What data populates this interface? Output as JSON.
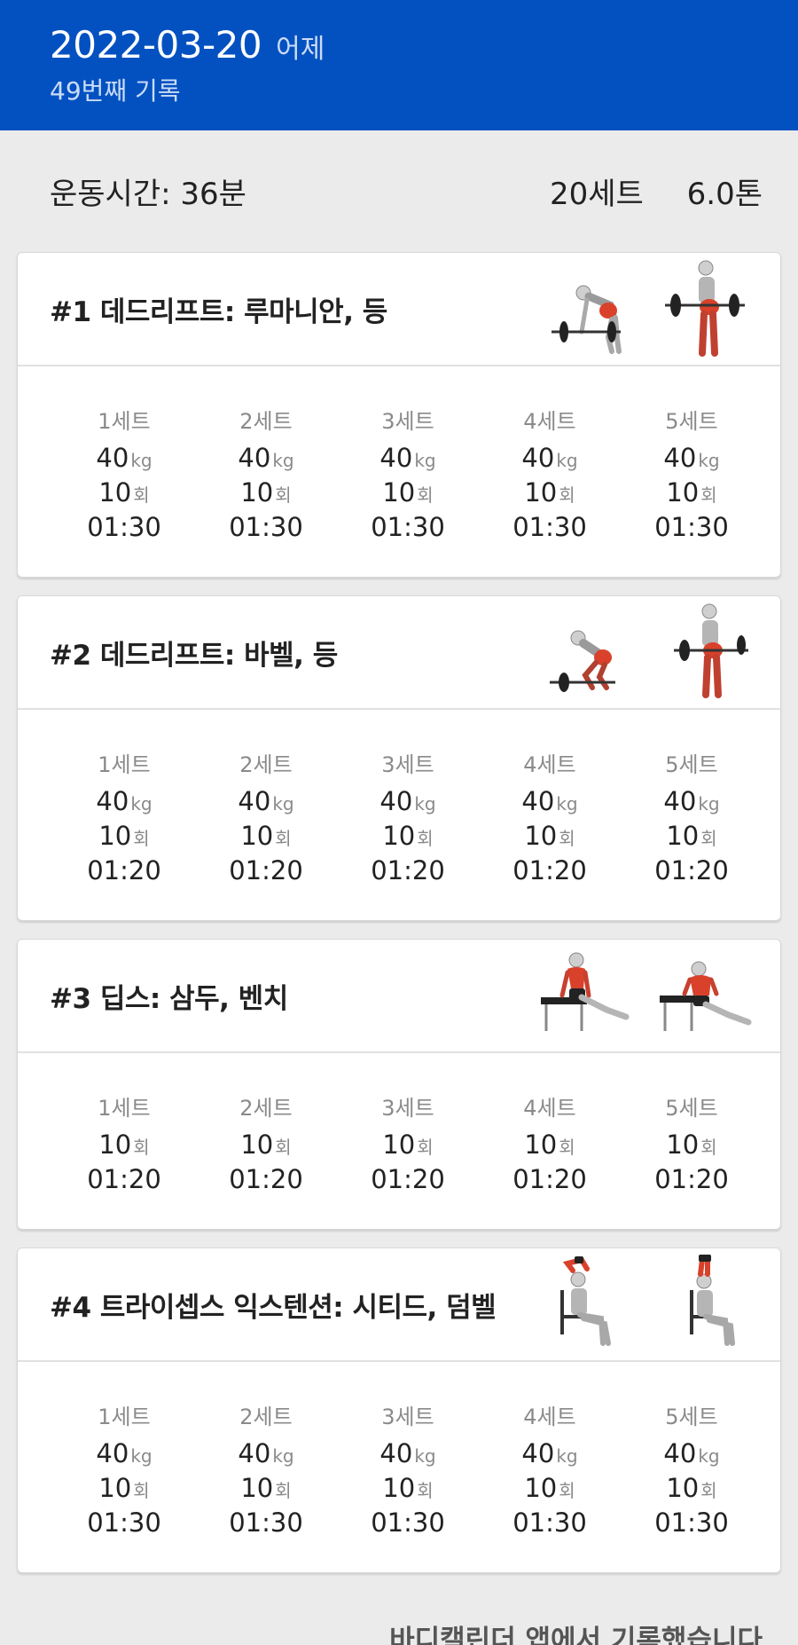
{
  "header": {
    "date": "2022-03-20",
    "relative": "어제",
    "count": "49번째 기록"
  },
  "summary": {
    "duration": "운동시간: 36분",
    "sets": "20세트",
    "tonnage": "6.0톤"
  },
  "exercises": [
    {
      "title": "#1 데드리프트: 루마니안, 등",
      "sets": [
        {
          "label": "1세트",
          "weight": "40",
          "weight_unit": "kg",
          "reps": "10",
          "reps_unit": "회",
          "rest": "01:30"
        },
        {
          "label": "2세트",
          "weight": "40",
          "weight_unit": "kg",
          "reps": "10",
          "reps_unit": "회",
          "rest": "01:30"
        },
        {
          "label": "3세트",
          "weight": "40",
          "weight_unit": "kg",
          "reps": "10",
          "reps_unit": "회",
          "rest": "01:30"
        },
        {
          "label": "4세트",
          "weight": "40",
          "weight_unit": "kg",
          "reps": "10",
          "reps_unit": "회",
          "rest": "01:30"
        },
        {
          "label": "5세트",
          "weight": "40",
          "weight_unit": "kg",
          "reps": "10",
          "reps_unit": "회",
          "rest": "01:30"
        }
      ]
    },
    {
      "title": "#2 데드리프트: 바벨, 등",
      "sets": [
        {
          "label": "1세트",
          "weight": "40",
          "weight_unit": "kg",
          "reps": "10",
          "reps_unit": "회",
          "rest": "01:20"
        },
        {
          "label": "2세트",
          "weight": "40",
          "weight_unit": "kg",
          "reps": "10",
          "reps_unit": "회",
          "rest": "01:20"
        },
        {
          "label": "3세트",
          "weight": "40",
          "weight_unit": "kg",
          "reps": "10",
          "reps_unit": "회",
          "rest": "01:20"
        },
        {
          "label": "4세트",
          "weight": "40",
          "weight_unit": "kg",
          "reps": "10",
          "reps_unit": "회",
          "rest": "01:20"
        },
        {
          "label": "5세트",
          "weight": "40",
          "weight_unit": "kg",
          "reps": "10",
          "reps_unit": "회",
          "rest": "01:20"
        }
      ]
    },
    {
      "title": "#3 딥스: 삼두, 벤치",
      "sets": [
        {
          "label": "1세트",
          "reps": "10",
          "reps_unit": "회",
          "rest": "01:20"
        },
        {
          "label": "2세트",
          "reps": "10",
          "reps_unit": "회",
          "rest": "01:20"
        },
        {
          "label": "3세트",
          "reps": "10",
          "reps_unit": "회",
          "rest": "01:20"
        },
        {
          "label": "4세트",
          "reps": "10",
          "reps_unit": "회",
          "rest": "01:20"
        },
        {
          "label": "5세트",
          "reps": "10",
          "reps_unit": "회",
          "rest": "01:20"
        }
      ]
    },
    {
      "title": "#4 트라이셉스 익스텐션: 시티드, 덤벨",
      "sets": [
        {
          "label": "1세트",
          "weight": "40",
          "weight_unit": "kg",
          "reps": "10",
          "reps_unit": "회",
          "rest": "01:30"
        },
        {
          "label": "2세트",
          "weight": "40",
          "weight_unit": "kg",
          "reps": "10",
          "reps_unit": "회",
          "rest": "01:30"
        },
        {
          "label": "3세트",
          "weight": "40",
          "weight_unit": "kg",
          "reps": "10",
          "reps_unit": "회",
          "rest": "01:30"
        },
        {
          "label": "4세트",
          "weight": "40",
          "weight_unit": "kg",
          "reps": "10",
          "reps_unit": "회",
          "rest": "01:30"
        },
        {
          "label": "5세트",
          "weight": "40",
          "weight_unit": "kg",
          "reps": "10",
          "reps_unit": "회",
          "rest": "01:30"
        }
      ]
    }
  ],
  "footer": {
    "text": "바디캘린더 앱에서 기록했습니다"
  },
  "colors": {
    "header_bg": "#0351c1",
    "muscle_highlight": "#d9412b"
  },
  "icons": [
    "romanian-deadlift-start-icon",
    "romanian-deadlift-end-icon",
    "barbell-deadlift-start-icon",
    "barbell-deadlift-end-icon",
    "bench-dips-start-icon",
    "bench-dips-end-icon",
    "seated-triceps-extension-start-icon",
    "seated-triceps-extension-end-icon"
  ]
}
